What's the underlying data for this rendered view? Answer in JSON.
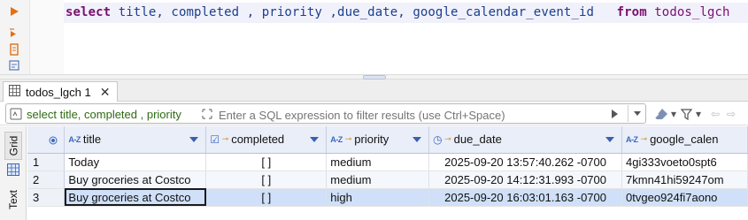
{
  "editor": {
    "sql_keyword_select": "select",
    "sql_columns": " title, completed , priority ,due_date, google_calendar_event_id   ",
    "sql_keyword_from": "from",
    "sql_table": "todos_lgch"
  },
  "result_tab": {
    "label": "todos_lgch 1",
    "close": "✕"
  },
  "filter": {
    "query_text": "select title, completed , priority",
    "placeholder": "Enter a SQL expression to filter results (use Ctrl+Space)"
  },
  "side_tabs": {
    "grid": "Grid",
    "text": "Text"
  },
  "columns": [
    {
      "label": "title",
      "type_badge": "A-Z"
    },
    {
      "label": "completed",
      "type_badge": "☑"
    },
    {
      "label": "priority",
      "type_badge": "A-Z"
    },
    {
      "label": "due_date",
      "type_badge": "◷"
    },
    {
      "label": "google_calen",
      "type_badge": "A-Z"
    }
  ],
  "rows": [
    {
      "n": "1",
      "title": "Today",
      "completed": "[ ]",
      "priority": "medium",
      "due_date": "2025-09-20 13:57:40.262 -0700",
      "gcal": "4gi333voeto0spt6"
    },
    {
      "n": "2",
      "title": "Buy groceries at Costco",
      "completed": "[ ]",
      "priority": "medium",
      "due_date": "2025-09-20 14:12:31.993 -0700",
      "gcal": "7kmn41hi59247om"
    },
    {
      "n": "3",
      "title": "Buy groceries at Costco",
      "completed": "[ ]",
      "priority": "high",
      "due_date": "2025-09-20 16:03:01.163 -0700",
      "gcal": "0tvgeo924fi7aono"
    }
  ],
  "colors": {
    "accent": "#3a67c0",
    "keyword": "#7a0f6e",
    "selection": "#cfe0f8",
    "header_bg": "#e9eef8"
  }
}
